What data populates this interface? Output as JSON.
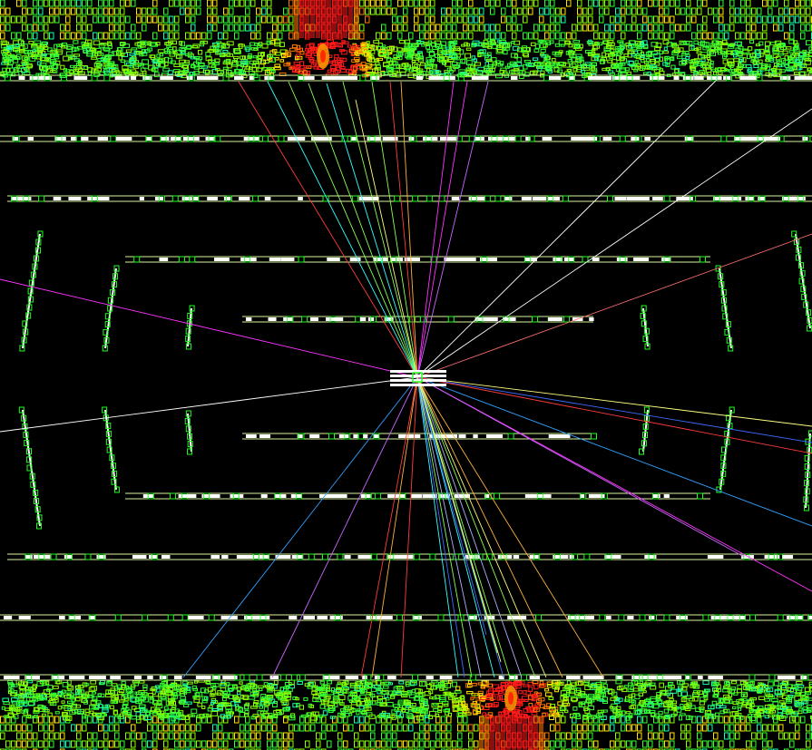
{
  "event_display": {
    "view": "side-view",
    "background_color": "#000000",
    "detector_layers": {
      "barrel_line_color": "#d8f5a0",
      "module_color": "#ffffff",
      "hit_color": "#22ff22"
    },
    "calorimeter_colors": [
      "#1f3cff",
      "#00e5ff",
      "#19ffb0",
      "#35ff35",
      "#8cff00",
      "#ffe600",
      "#ff7a00",
      "#ff1a1a"
    ],
    "track_colors": [
      "#ff3c3c",
      "#ff33ff",
      "#33ffff",
      "#88ff55",
      "#ffffff",
      "#3f6cff",
      "#ffb040",
      "#ffff80",
      "#b0b0ff",
      "#cc66ff",
      "#30a0ff",
      "#ff7070"
    ],
    "calorimeter_hotspots": [
      {
        "id": "top-hotspot",
        "intensity": 0.92
      },
      {
        "id": "bottom-hotspot",
        "intensity": 0.97
      }
    ]
  }
}
